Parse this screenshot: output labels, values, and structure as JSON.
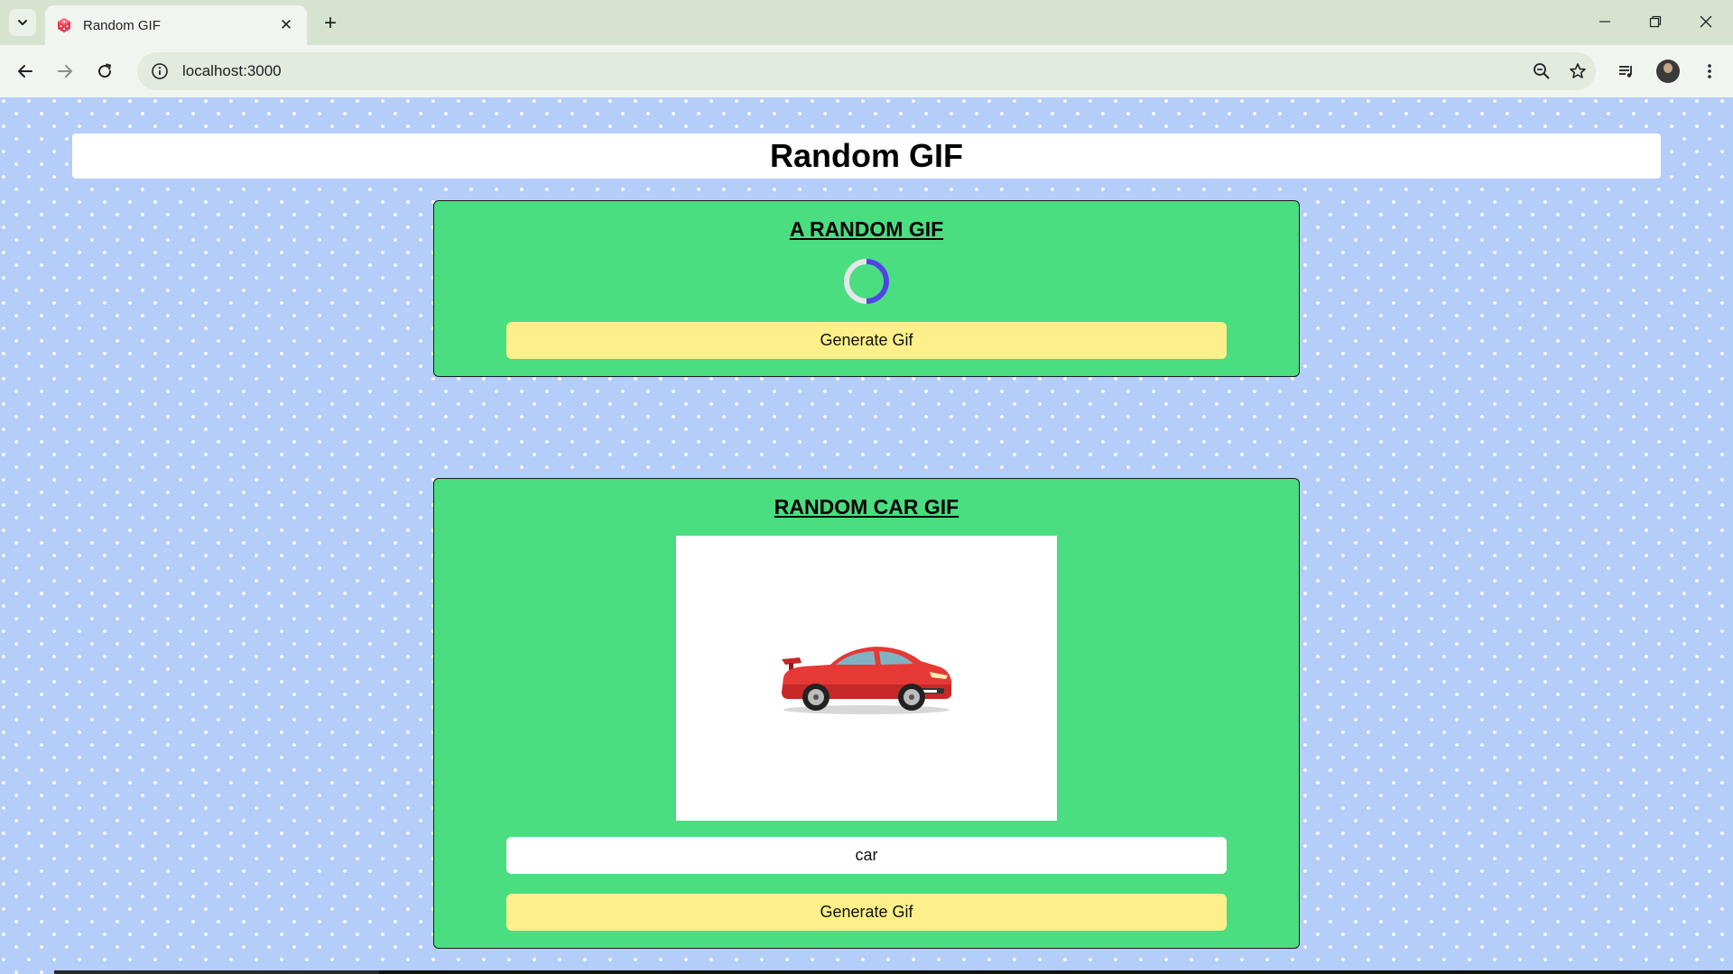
{
  "browser": {
    "tab_title": "Random GIF",
    "tab_close": "✕",
    "new_tab": "+",
    "url": "localhost:3000"
  },
  "page": {
    "title": "Random GIF"
  },
  "random_card": {
    "title": "A RANDOM GIF",
    "button_label": "Generate Gif",
    "loading": true
  },
  "car_card": {
    "title": "RANDOM CAR GIF",
    "search_value": "car",
    "button_label": "Generate Gif"
  },
  "colors": {
    "page_background": "#b4cdf9",
    "card_background": "#4ade80",
    "button_background": "#fdf08a",
    "spinner_accent": "#4f46e5",
    "car_body": "#e53935"
  }
}
